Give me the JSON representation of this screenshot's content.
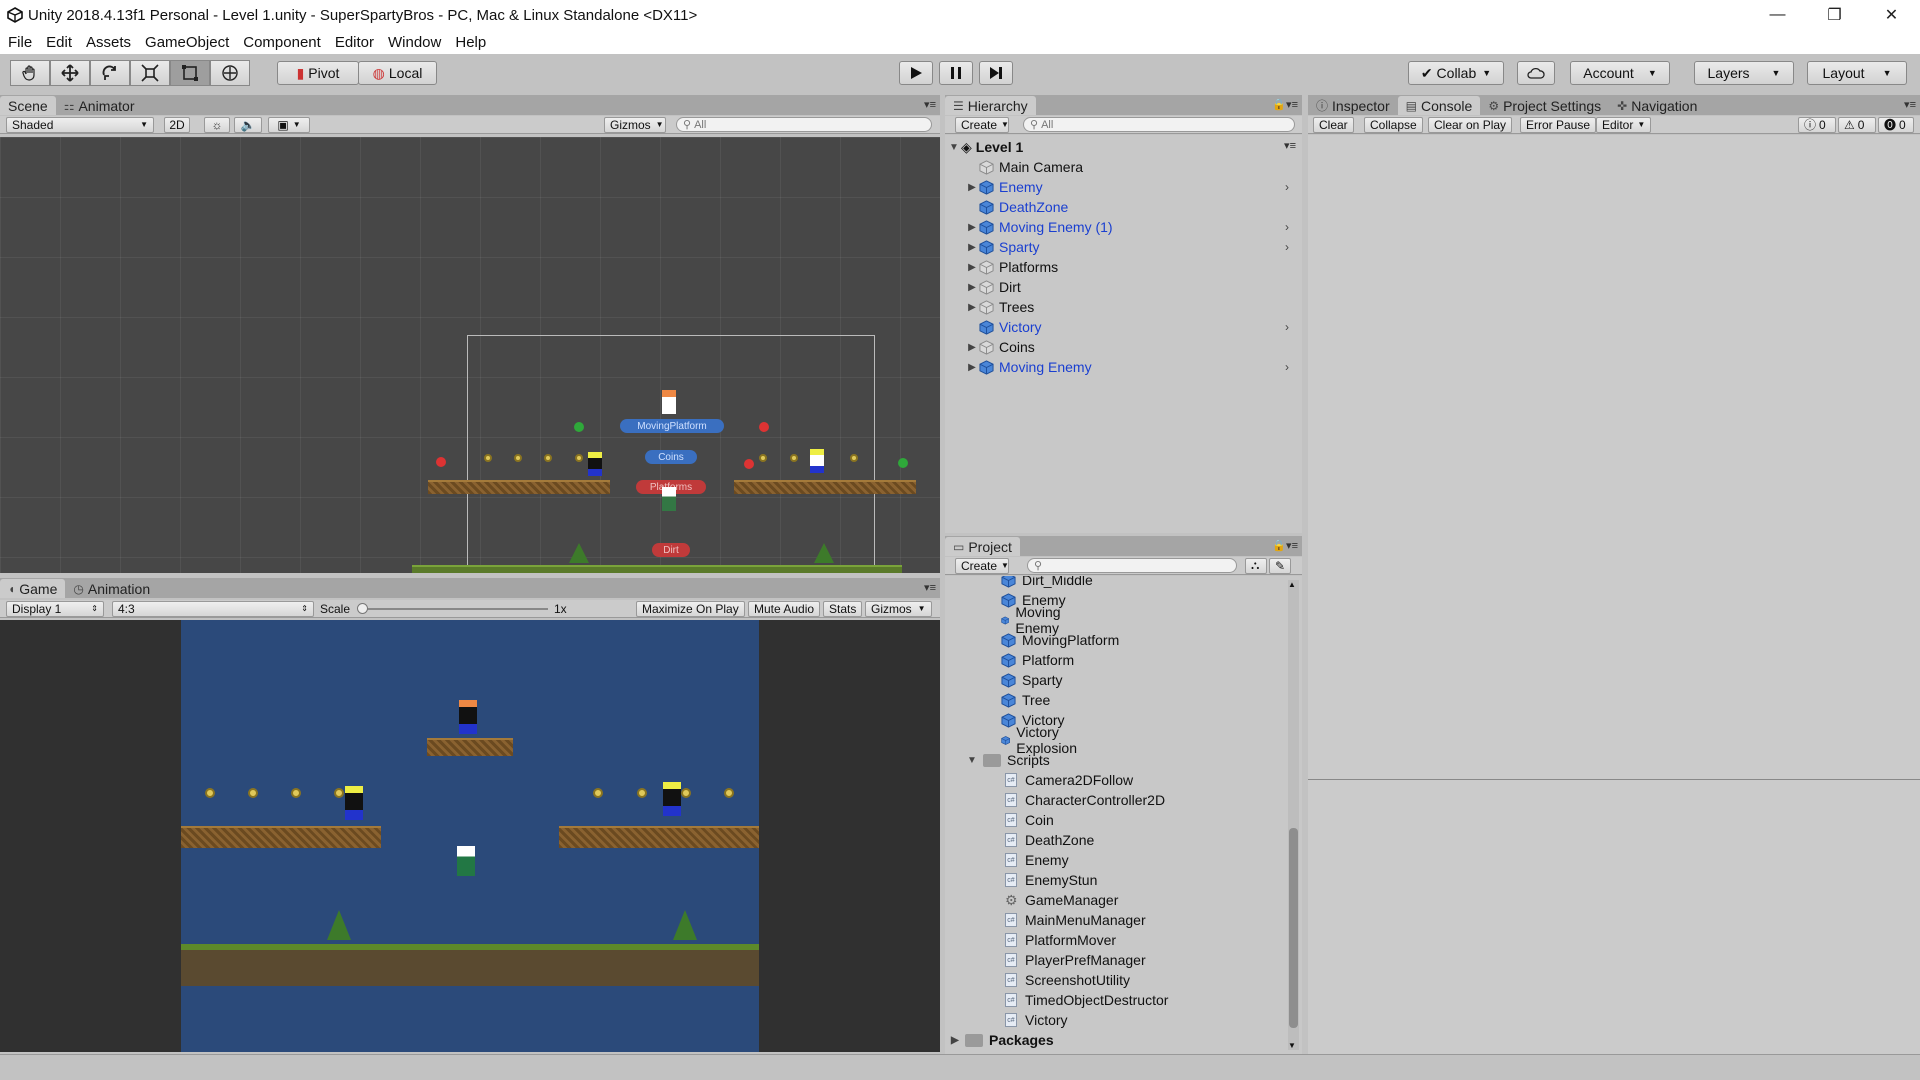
{
  "window": {
    "title": "Unity 2018.4.13f1 Personal - Level 1.unity - SuperSpartyBros - PC, Mac & Linux Standalone <DX11>",
    "minimize": "—",
    "maximize": "❐",
    "close": "✕"
  },
  "menu": [
    "File",
    "Edit",
    "Assets",
    "GameObject",
    "Component",
    "Editor",
    "Window",
    "Help"
  ],
  "toolbar": {
    "pivot": "Pivot",
    "local": "Local",
    "collab": "Collab",
    "account": "Account",
    "layers": "Layers",
    "layout": "Layout"
  },
  "scene_panel": {
    "tabs": [
      "Scene",
      "Animator"
    ],
    "shading": "Shaded",
    "mode_2d": "2D",
    "gizmos": "Gizmos",
    "search_placeholder": "All",
    "labels": {
      "moving_platform": "MovingPlatform",
      "coins": "Coins",
      "platforms": "Platforms",
      "dirt": "Dirt"
    }
  },
  "game_panel": {
    "tabs": [
      "Game",
      "Animation"
    ],
    "display": "Display 1",
    "aspect": "4:3",
    "scale_label": "Scale",
    "scale_value": "1x",
    "buttons": [
      "Maximize On Play",
      "Mute Audio",
      "Stats",
      "Gizmos"
    ]
  },
  "hierarchy": {
    "tab": "Hierarchy",
    "create": "Create",
    "search_placeholder": "All",
    "scene": "Level 1",
    "items": [
      {
        "label": "Main Camera",
        "prefab": false,
        "expandable": false
      },
      {
        "label": "Enemy",
        "prefab": true,
        "expandable": true
      },
      {
        "label": "DeathZone",
        "prefab": true,
        "expandable": false
      },
      {
        "label": "Moving Enemy (1)",
        "prefab": true,
        "expandable": true
      },
      {
        "label": "Sparty",
        "prefab": true,
        "expandable": true
      },
      {
        "label": "Platforms",
        "prefab": false,
        "expandable": true
      },
      {
        "label": "Dirt",
        "prefab": false,
        "expandable": true
      },
      {
        "label": "Trees",
        "prefab": false,
        "expandable": true
      },
      {
        "label": "Victory",
        "prefab": true,
        "expandable": false
      },
      {
        "label": "Coins",
        "prefab": false,
        "expandable": true
      },
      {
        "label": "Moving Enemy",
        "prefab": true,
        "expandable": true
      }
    ]
  },
  "inspector": {
    "tabs": [
      "Inspector",
      "Console",
      "Project Settings",
      "Navigation"
    ],
    "console_buttons": [
      "Clear",
      "Collapse",
      "Clear on Play",
      "Error Pause",
      "Editor"
    ],
    "counts": {
      "info": "0",
      "warn": "0",
      "error": "0"
    }
  },
  "project": {
    "tab": "Project",
    "create": "Create",
    "prefabs": [
      "Dirt_Middle",
      "Enemy",
      "Moving Enemy",
      "MovingPlatform",
      "Platform",
      "Sparty",
      "Tree",
      "Victory",
      "Victory Explosion"
    ],
    "scripts_folder": "Scripts",
    "scripts": [
      "Camera2DFollow",
      "CharacterController2D",
      "Coin",
      "DeathZone",
      "Enemy",
      "EnemyStun",
      "GameManager",
      "MainMenuManager",
      "PlatformMover",
      "PlayerPrefManager",
      "ScreenshotUtility",
      "TimedObjectDestructor",
      "Victory"
    ],
    "packages_folder": "Packages"
  },
  "colors": {
    "prefab_blue": "#1a3fd0",
    "game_bg": "#2b4a7a",
    "scene_bg": "#474747"
  }
}
